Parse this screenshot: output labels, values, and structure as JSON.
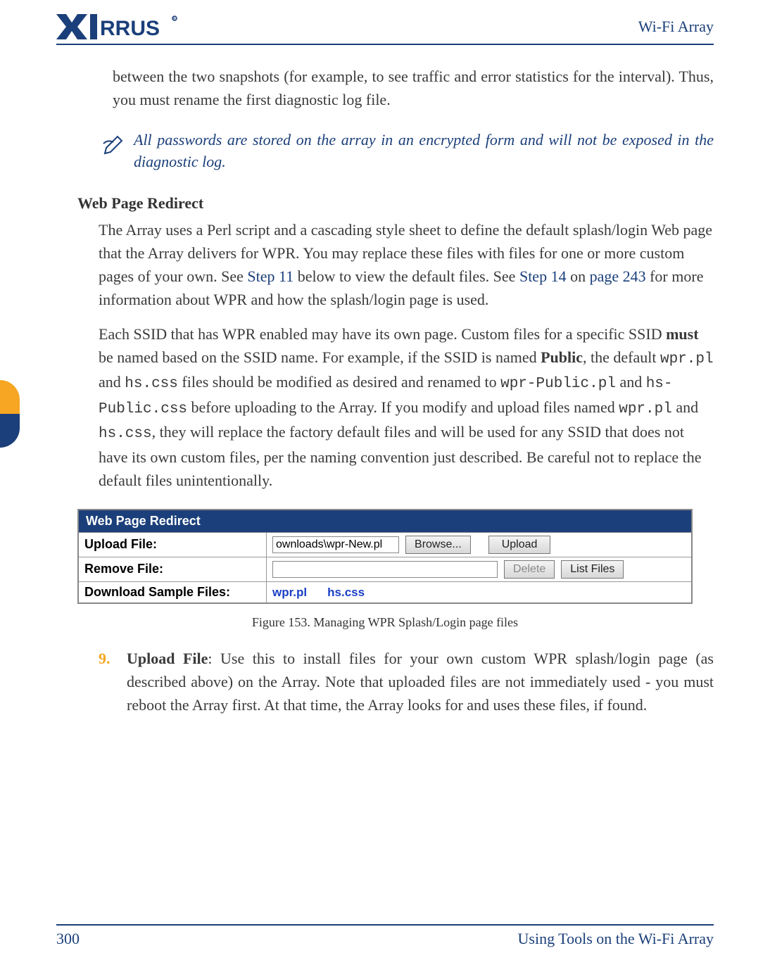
{
  "header": {
    "brand": "XIRRUS",
    "title": "Wi-Fi Array"
  },
  "intro_continuation": "between the two snapshots (for example, to see traffic and error statistics for the interval). Thus, you must rename the first diagnostic log file.",
  "note": {
    "text": "All passwords are stored on the array in an encrypted form and will not be exposed in the diagnostic log."
  },
  "section": {
    "heading": "Web Page Redirect",
    "p1_a": "The Array uses a Perl script and a cascading style sheet to define the default splash/login Web page that the Array delivers for WPR. You may replace these files with files for one or more custom pages of your own. See ",
    "p1_link1": "Step 11",
    "p1_b": " below to view the default files. See ",
    "p1_link2": "Step 14",
    "p1_c": " on ",
    "p1_link3": "page 243",
    "p1_d": " for more information about WPR and how the splash/login page is used.",
    "p2_a": "Each SSID that has WPR enabled may have its own page. Custom files for a specific SSID ",
    "p2_must": "must",
    "p2_b": " be named based on the SSID name. For example, if the SSID is named ",
    "p2_public": "Public",
    "p2_c": ", the default ",
    "p2_code1": "wpr.pl",
    "p2_d": " and ",
    "p2_code2": "hs.css",
    "p2_e": " files should be modified as desired and renamed to ",
    "p2_code3": "wpr-Public.pl",
    "p2_f": " and ",
    "p2_code4": "hs-Public.css",
    "p2_g": " before uploading to the Array. If you modify and upload files named ",
    "p2_code5": "wpr.pl",
    "p2_h": " and ",
    "p2_code6": "hs.css",
    "p2_i": ", they will replace the factory default files and will be used for any SSID that does not have its own custom files, per the naming convention just described. Be careful not to replace the default files unintentionally."
  },
  "wpr_ui": {
    "panel_title": "Web Page Redirect",
    "rows": {
      "upload": {
        "label": "Upload File:",
        "value": "ownloads\\wpr-New.pl",
        "browse": "Browse...",
        "upload_btn": "Upload"
      },
      "remove": {
        "label": "Remove File:",
        "value": "",
        "delete_btn": "Delete",
        "list_btn": "List Files"
      },
      "download": {
        "label": "Download Sample Files:",
        "link1": "wpr.pl",
        "link2": "hs.css"
      }
    }
  },
  "figure_caption": "Figure 153. Managing WPR Splash/Login page files",
  "list": {
    "n9_marker": "9.",
    "n9_bold": "Upload File",
    "n9_text": ": Use this to install files for your own custom WPR splash/login page (as described above) on the Array. Note that uploaded files are not immediately used - you must reboot the Array first. At that time, the Array looks for and uses these files, if found."
  },
  "footer": {
    "page": "300",
    "title": "Using Tools on the Wi-Fi Array"
  }
}
